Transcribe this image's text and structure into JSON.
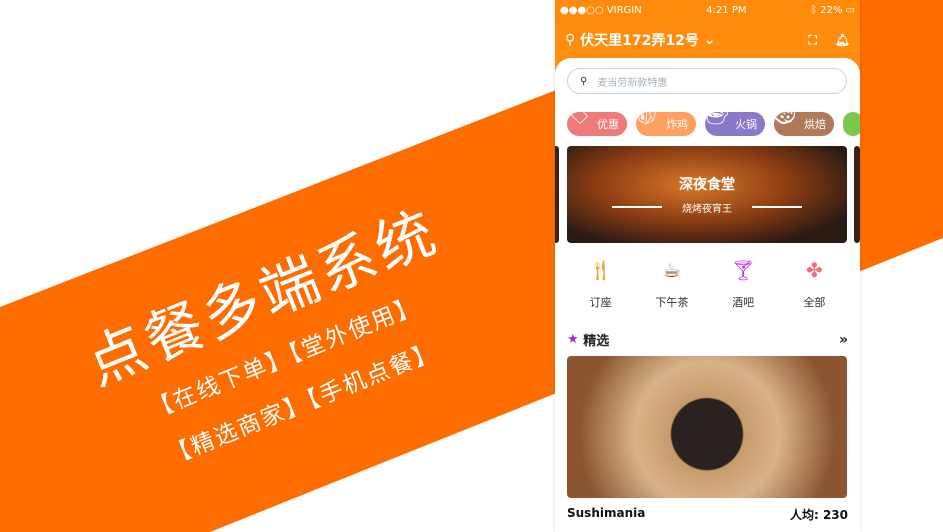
{
  "promo": {
    "title": "点餐多端系统",
    "line1": "【在线下单】【堂外使用】",
    "line2": "【精选商家】【手机点餐】"
  },
  "colors": {
    "brand": "#ff6c00",
    "header": "#ff8a0c"
  },
  "status": {
    "carrier": "●●●○○ VIRGIN",
    "time": "4:21 PM",
    "battery": "22%"
  },
  "header": {
    "location": "伏天里172弄12号"
  },
  "search": {
    "placeholder": "麦当劳新款特惠"
  },
  "categories": [
    {
      "label": "优惠",
      "color": "#ee7a7a"
    },
    {
      "label": "炸鸡",
      "color": "#ff9f60"
    },
    {
      "label": "火锅",
      "color": "#8a78c8"
    },
    {
      "label": "烘焙",
      "color": "#b07a5a"
    }
  ],
  "banner": {
    "title": "深夜食堂",
    "subtitle": "烧烤夜宵王"
  },
  "quick": [
    {
      "label": "订座",
      "icon": "utensils-icon"
    },
    {
      "label": "下午茶",
      "icon": "coffee-icon"
    },
    {
      "label": "酒吧",
      "icon": "cocktail-icon"
    },
    {
      "label": "全部",
      "icon": "clover-icon"
    }
  ],
  "section": {
    "title": "精选"
  },
  "restaurant": {
    "name": "Sushimania",
    "price": "人均: 230"
  }
}
